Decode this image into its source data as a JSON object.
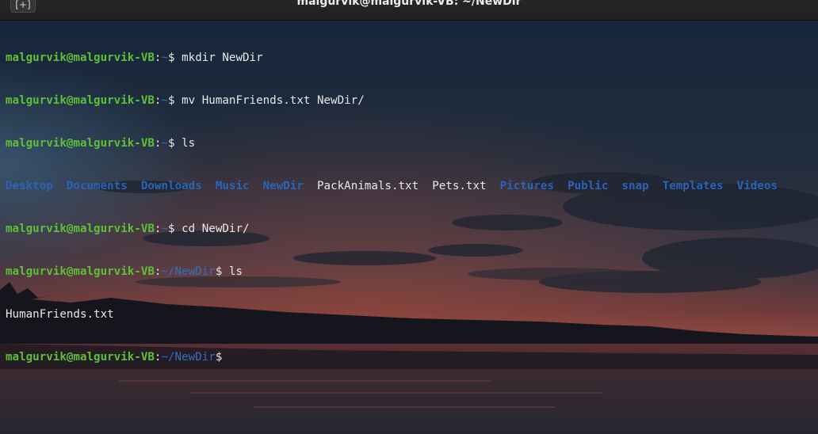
{
  "window": {
    "title": "malgurvik@malgurvik-VB: ~/NewDir",
    "new_tab_glyph": "[+]"
  },
  "terminal": {
    "user_host": "malgurvik@malgurvik-VB",
    "lines": [
      {
        "path": "~",
        "command": "mkdir NewDir"
      },
      {
        "path": "~",
        "command": "mv HumanFriends.txt NewDir/"
      },
      {
        "path": "~",
        "command": "ls"
      },
      {
        "path": "~",
        "command": "cd NewDir/"
      },
      {
        "path": "~/NewDir",
        "command": "ls"
      },
      {
        "path": "~/NewDir",
        "command": ""
      }
    ],
    "ls_home_output": [
      {
        "name": "Desktop",
        "kind": "dir"
      },
      {
        "name": "Documents",
        "kind": "dir"
      },
      {
        "name": "Downloads",
        "kind": "dir"
      },
      {
        "name": "Music",
        "kind": "dir"
      },
      {
        "name": "NewDir",
        "kind": "dir"
      },
      {
        "name": "PackAnimals.txt",
        "kind": "file"
      },
      {
        "name": "Pets.txt",
        "kind": "file"
      },
      {
        "name": "Pictures",
        "kind": "dir"
      },
      {
        "name": "Public",
        "kind": "dir"
      },
      {
        "name": "snap",
        "kind": "dir"
      },
      {
        "name": "Templates",
        "kind": "dir"
      },
      {
        "name": "Videos",
        "kind": "dir"
      }
    ],
    "ls_newdir_output": "HumanFriends.txt",
    "colors": {
      "user_host": "#5fbf38",
      "path": "#2f6fc4",
      "directory": "#2a63b8",
      "text": "#e8e8e8"
    }
  }
}
